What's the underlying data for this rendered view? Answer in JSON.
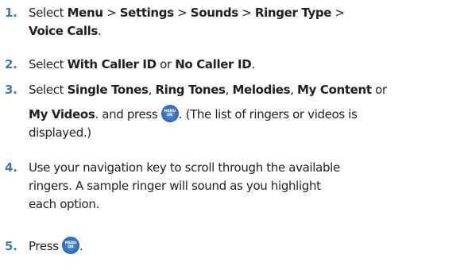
{
  "steps": [
    {
      "number": "1.",
      "lines": [
        [
          {
            "t": "Select "
          },
          {
            "t": "Menu",
            "b": true
          },
          {
            "t": " > "
          },
          {
            "t": "Settings",
            "b": true
          },
          {
            "t": " > "
          },
          {
            "t": "Sounds",
            "b": true
          },
          {
            "t": " > "
          },
          {
            "t": "Ringer Type",
            "b": true
          },
          {
            "t": " >"
          }
        ],
        [
          {
            "t": "Voice Calls",
            "b": true
          },
          {
            "t": "."
          }
        ]
      ]
    },
    {
      "number": "2.",
      "lines": [
        [
          {
            "t": "Select "
          },
          {
            "t": "With Caller ID",
            "b": true
          },
          {
            "t": " or "
          },
          {
            "t": "No Caller ID",
            "b": true
          },
          {
            "t": "."
          }
        ]
      ]
    },
    {
      "number": "3.",
      "lines": [
        [
          {
            "t": "Select "
          },
          {
            "t": "Single Tones",
            "b": true
          },
          {
            "t": ", "
          },
          {
            "t": "Ring Tones",
            "b": true
          },
          {
            "t": ", "
          },
          {
            "t": "Melodies",
            "b": true
          },
          {
            "t": ", "
          },
          {
            "t": "My Content",
            "b": true
          },
          {
            "t": " or"
          }
        ],
        [
          {
            "t": "My Videos",
            "b": true
          },
          {
            "t": ". and press "
          },
          {
            "key": true
          },
          {
            "t": ". (The list of ringers or videos is"
          }
        ],
        [
          {
            "t": "displayed.)"
          }
        ]
      ]
    },
    {
      "number": "4.",
      "lines": [
        [
          {
            "t": "Use your navigation key to scroll through the available"
          }
        ],
        [
          {
            "t": "ringers. A sample ringer will sound as you highlight"
          }
        ],
        [
          {
            "t": "each option."
          }
        ]
      ]
    },
    {
      "number": "5.",
      "lines": [
        [
          {
            "t": "Press "
          },
          {
            "key": true
          },
          {
            "t": "."
          }
        ]
      ]
    }
  ],
  "menu_ok_key": {
    "icon": "menu-ok-key-icon",
    "line1": "MENU",
    "line2": "OK",
    "color": "#3173bf"
  }
}
